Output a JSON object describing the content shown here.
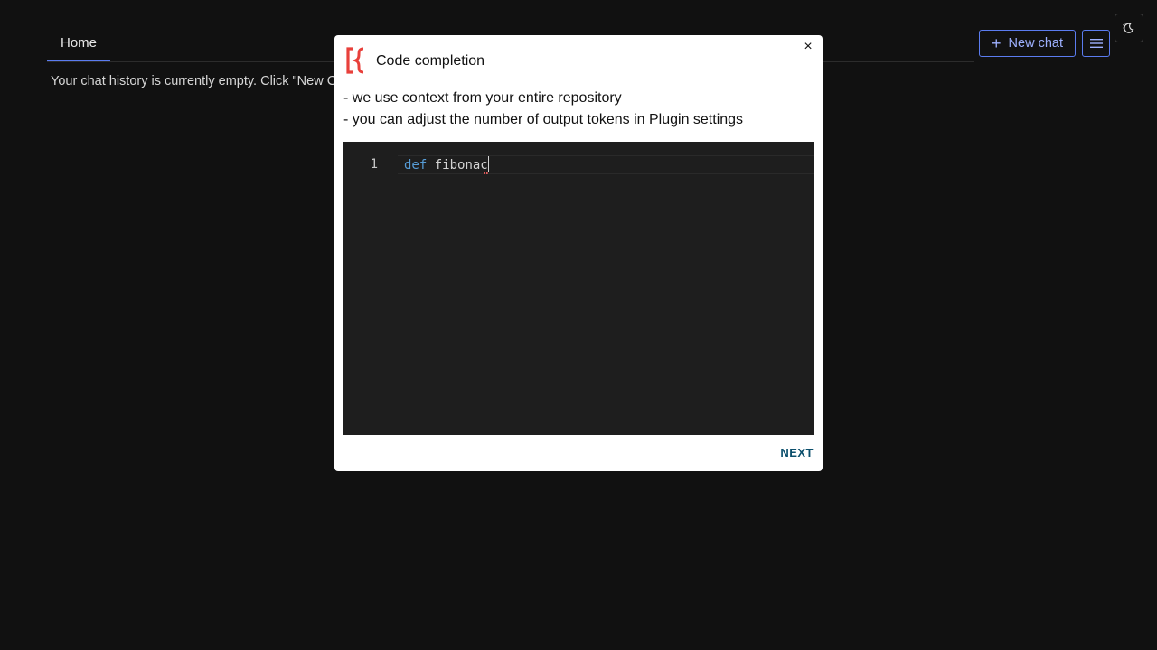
{
  "tabs": {
    "home_label": "Home"
  },
  "history": {
    "empty_text": "Your chat history is currently empty. Click \"New C"
  },
  "toolbar": {
    "new_chat_label": "New chat",
    "new_chat_icon": "plus-icon",
    "menu_icon": "hamburger-icon",
    "theme_icon": "theme-toggle-icon"
  },
  "modal": {
    "close_label": "×",
    "title": "Code completion",
    "desc_line1": "- we use context from your entire repository",
    "desc_line2": "- you can adjust the number of output tokens in Plugin settings",
    "editor": {
      "line_number": "1",
      "keyword": "def",
      "code_rest": " fibonac"
    },
    "next_label": "NEXT"
  },
  "colors": {
    "background": "#111111",
    "accent": "#5b7cf0",
    "logo_red": "#e8403b",
    "next_text": "#0b4f6c",
    "editor_bg": "#1e1e1e",
    "keyword": "#569cd6"
  }
}
